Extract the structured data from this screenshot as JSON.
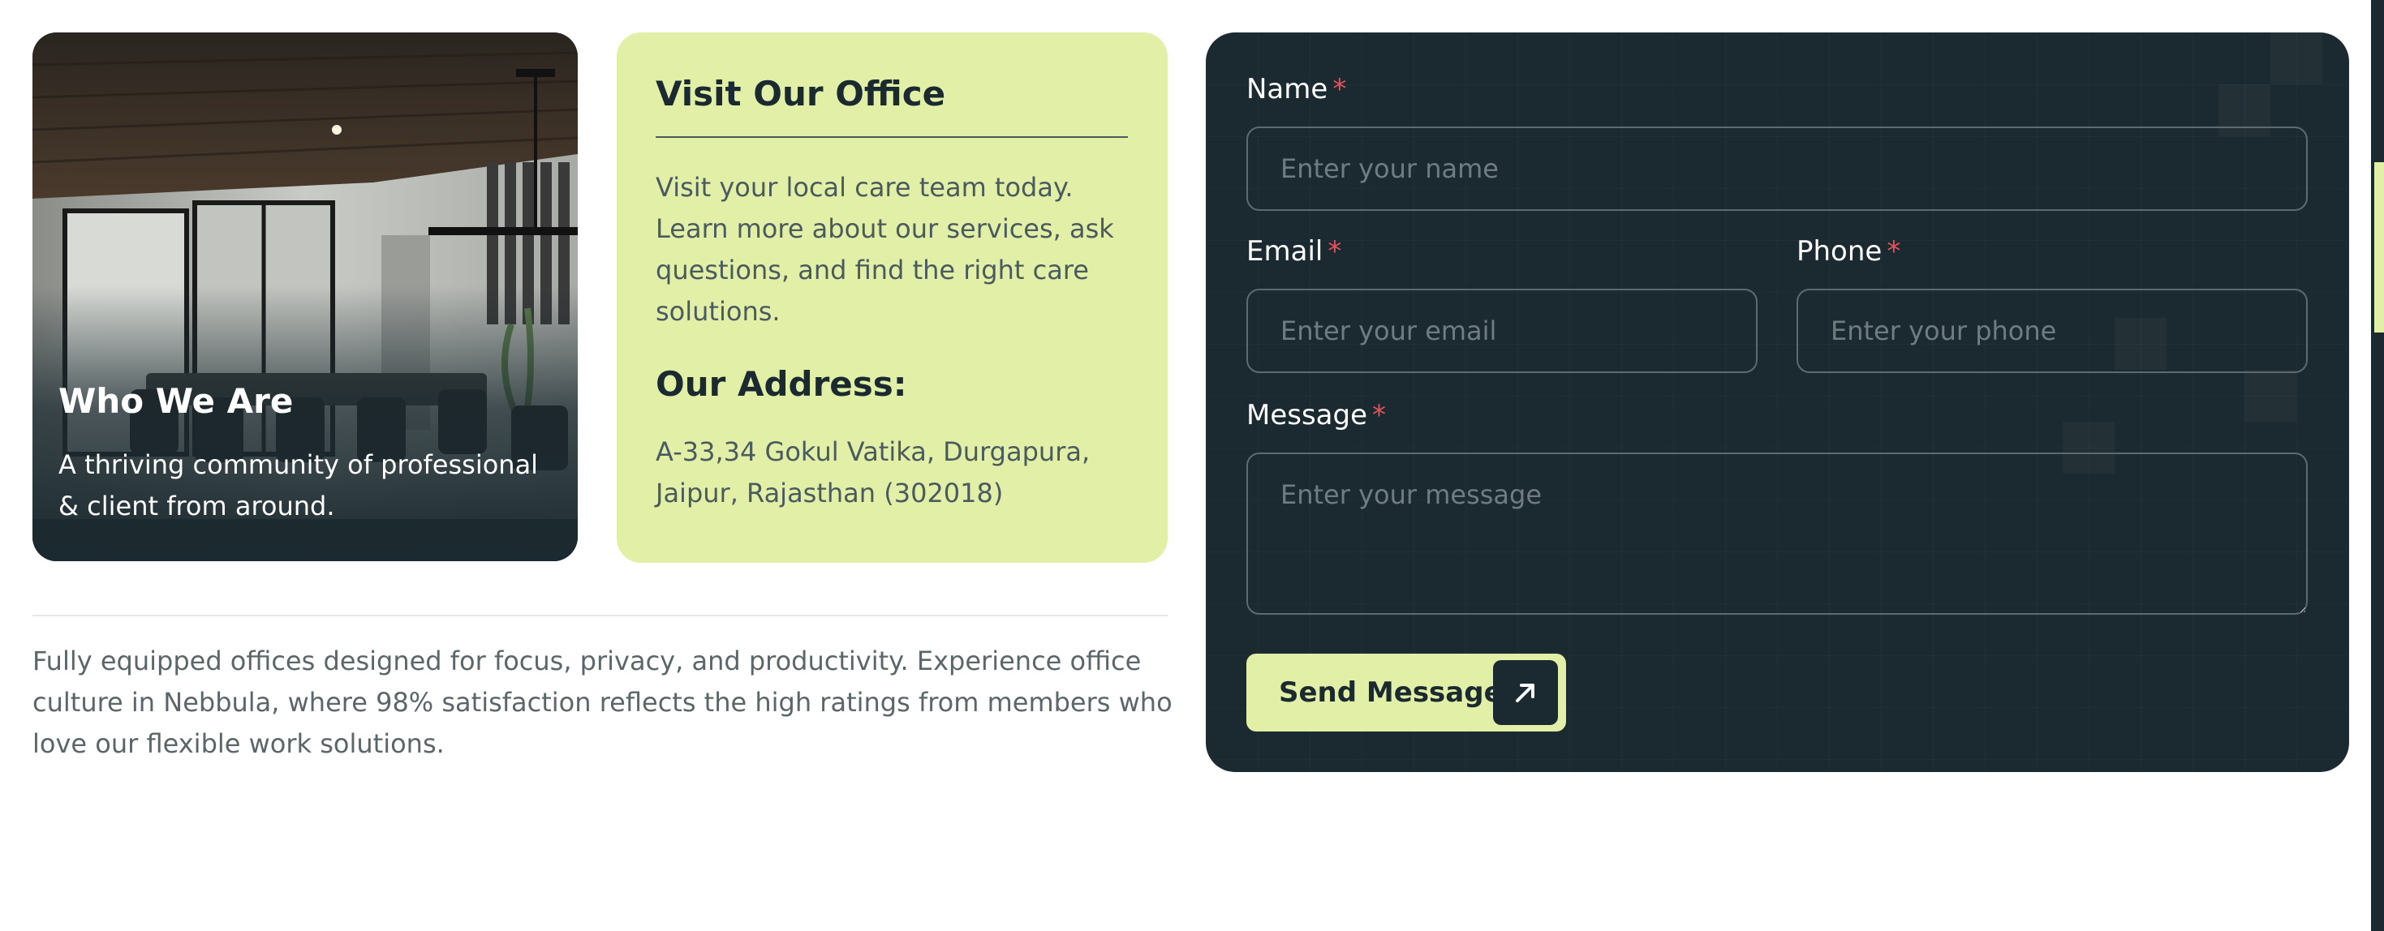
{
  "who_card": {
    "title": "Who We Are",
    "text": "A thriving community of professional & client from around."
  },
  "visit_card": {
    "title": "Visit Our Office",
    "text": "Visit your local care team today. Learn more about our services, ask questions, and find the right care solutions.",
    "address_title": "Our Address:",
    "address": "A-33,34 Gokul Vatika, Durgapura, Jaipur, Rajasthan (302018)"
  },
  "bottom_text": "Fully equipped offices designed for focus, privacy, and productivity. Experience office culture in Nebbula, where 98% satisfaction reflects the high ratings from members who love our flexible work solutions.",
  "form": {
    "required_mark": "*",
    "name": {
      "label": "Name",
      "placeholder": "Enter your name"
    },
    "email": {
      "label": "Email",
      "placeholder": "Enter your email"
    },
    "phone": {
      "label": "Phone",
      "placeholder": "Enter your phone"
    },
    "message": {
      "label": "Message",
      "placeholder": "Enter your message"
    },
    "submit_label": "Send Message",
    "submit_icon": "arrow-up-right-icon"
  },
  "colors": {
    "dark": "#1b2a30",
    "accent": "#e1f0a6",
    "required": "#e4525e",
    "body_text": "#4b5a5e"
  }
}
